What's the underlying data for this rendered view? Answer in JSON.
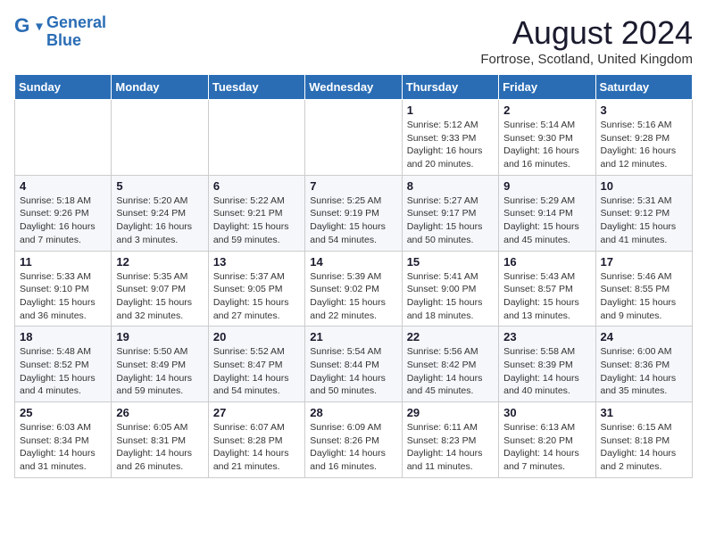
{
  "logo": {
    "line1": "General",
    "line2": "Blue"
  },
  "title": "August 2024",
  "subtitle": "Fortrose, Scotland, United Kingdom",
  "headers": [
    "Sunday",
    "Monday",
    "Tuesday",
    "Wednesday",
    "Thursday",
    "Friday",
    "Saturday"
  ],
  "weeks": [
    [
      {
        "day": "",
        "info": ""
      },
      {
        "day": "",
        "info": ""
      },
      {
        "day": "",
        "info": ""
      },
      {
        "day": "",
        "info": ""
      },
      {
        "day": "1",
        "info": "Sunrise: 5:12 AM\nSunset: 9:33 PM\nDaylight: 16 hours\nand 20 minutes."
      },
      {
        "day": "2",
        "info": "Sunrise: 5:14 AM\nSunset: 9:30 PM\nDaylight: 16 hours\nand 16 minutes."
      },
      {
        "day": "3",
        "info": "Sunrise: 5:16 AM\nSunset: 9:28 PM\nDaylight: 16 hours\nand 12 minutes."
      }
    ],
    [
      {
        "day": "4",
        "info": "Sunrise: 5:18 AM\nSunset: 9:26 PM\nDaylight: 16 hours\nand 7 minutes."
      },
      {
        "day": "5",
        "info": "Sunrise: 5:20 AM\nSunset: 9:24 PM\nDaylight: 16 hours\nand 3 minutes."
      },
      {
        "day": "6",
        "info": "Sunrise: 5:22 AM\nSunset: 9:21 PM\nDaylight: 15 hours\nand 59 minutes."
      },
      {
        "day": "7",
        "info": "Sunrise: 5:25 AM\nSunset: 9:19 PM\nDaylight: 15 hours\nand 54 minutes."
      },
      {
        "day": "8",
        "info": "Sunrise: 5:27 AM\nSunset: 9:17 PM\nDaylight: 15 hours\nand 50 minutes."
      },
      {
        "day": "9",
        "info": "Sunrise: 5:29 AM\nSunset: 9:14 PM\nDaylight: 15 hours\nand 45 minutes."
      },
      {
        "day": "10",
        "info": "Sunrise: 5:31 AM\nSunset: 9:12 PM\nDaylight: 15 hours\nand 41 minutes."
      }
    ],
    [
      {
        "day": "11",
        "info": "Sunrise: 5:33 AM\nSunset: 9:10 PM\nDaylight: 15 hours\nand 36 minutes."
      },
      {
        "day": "12",
        "info": "Sunrise: 5:35 AM\nSunset: 9:07 PM\nDaylight: 15 hours\nand 32 minutes."
      },
      {
        "day": "13",
        "info": "Sunrise: 5:37 AM\nSunset: 9:05 PM\nDaylight: 15 hours\nand 27 minutes."
      },
      {
        "day": "14",
        "info": "Sunrise: 5:39 AM\nSunset: 9:02 PM\nDaylight: 15 hours\nand 22 minutes."
      },
      {
        "day": "15",
        "info": "Sunrise: 5:41 AM\nSunset: 9:00 PM\nDaylight: 15 hours\nand 18 minutes."
      },
      {
        "day": "16",
        "info": "Sunrise: 5:43 AM\nSunset: 8:57 PM\nDaylight: 15 hours\nand 13 minutes."
      },
      {
        "day": "17",
        "info": "Sunrise: 5:46 AM\nSunset: 8:55 PM\nDaylight: 15 hours\nand 9 minutes."
      }
    ],
    [
      {
        "day": "18",
        "info": "Sunrise: 5:48 AM\nSunset: 8:52 PM\nDaylight: 15 hours\nand 4 minutes."
      },
      {
        "day": "19",
        "info": "Sunrise: 5:50 AM\nSunset: 8:49 PM\nDaylight: 14 hours\nand 59 minutes."
      },
      {
        "day": "20",
        "info": "Sunrise: 5:52 AM\nSunset: 8:47 PM\nDaylight: 14 hours\nand 54 minutes."
      },
      {
        "day": "21",
        "info": "Sunrise: 5:54 AM\nSunset: 8:44 PM\nDaylight: 14 hours\nand 50 minutes."
      },
      {
        "day": "22",
        "info": "Sunrise: 5:56 AM\nSunset: 8:42 PM\nDaylight: 14 hours\nand 45 minutes."
      },
      {
        "day": "23",
        "info": "Sunrise: 5:58 AM\nSunset: 8:39 PM\nDaylight: 14 hours\nand 40 minutes."
      },
      {
        "day": "24",
        "info": "Sunrise: 6:00 AM\nSunset: 8:36 PM\nDaylight: 14 hours\nand 35 minutes."
      }
    ],
    [
      {
        "day": "25",
        "info": "Sunrise: 6:03 AM\nSunset: 8:34 PM\nDaylight: 14 hours\nand 31 minutes."
      },
      {
        "day": "26",
        "info": "Sunrise: 6:05 AM\nSunset: 8:31 PM\nDaylight: 14 hours\nand 26 minutes."
      },
      {
        "day": "27",
        "info": "Sunrise: 6:07 AM\nSunset: 8:28 PM\nDaylight: 14 hours\nand 21 minutes."
      },
      {
        "day": "28",
        "info": "Sunrise: 6:09 AM\nSunset: 8:26 PM\nDaylight: 14 hours\nand 16 minutes."
      },
      {
        "day": "29",
        "info": "Sunrise: 6:11 AM\nSunset: 8:23 PM\nDaylight: 14 hours\nand 11 minutes."
      },
      {
        "day": "30",
        "info": "Sunrise: 6:13 AM\nSunset: 8:20 PM\nDaylight: 14 hours\nand 7 minutes."
      },
      {
        "day": "31",
        "info": "Sunrise: 6:15 AM\nSunset: 8:18 PM\nDaylight: 14 hours\nand 2 minutes."
      }
    ]
  ]
}
